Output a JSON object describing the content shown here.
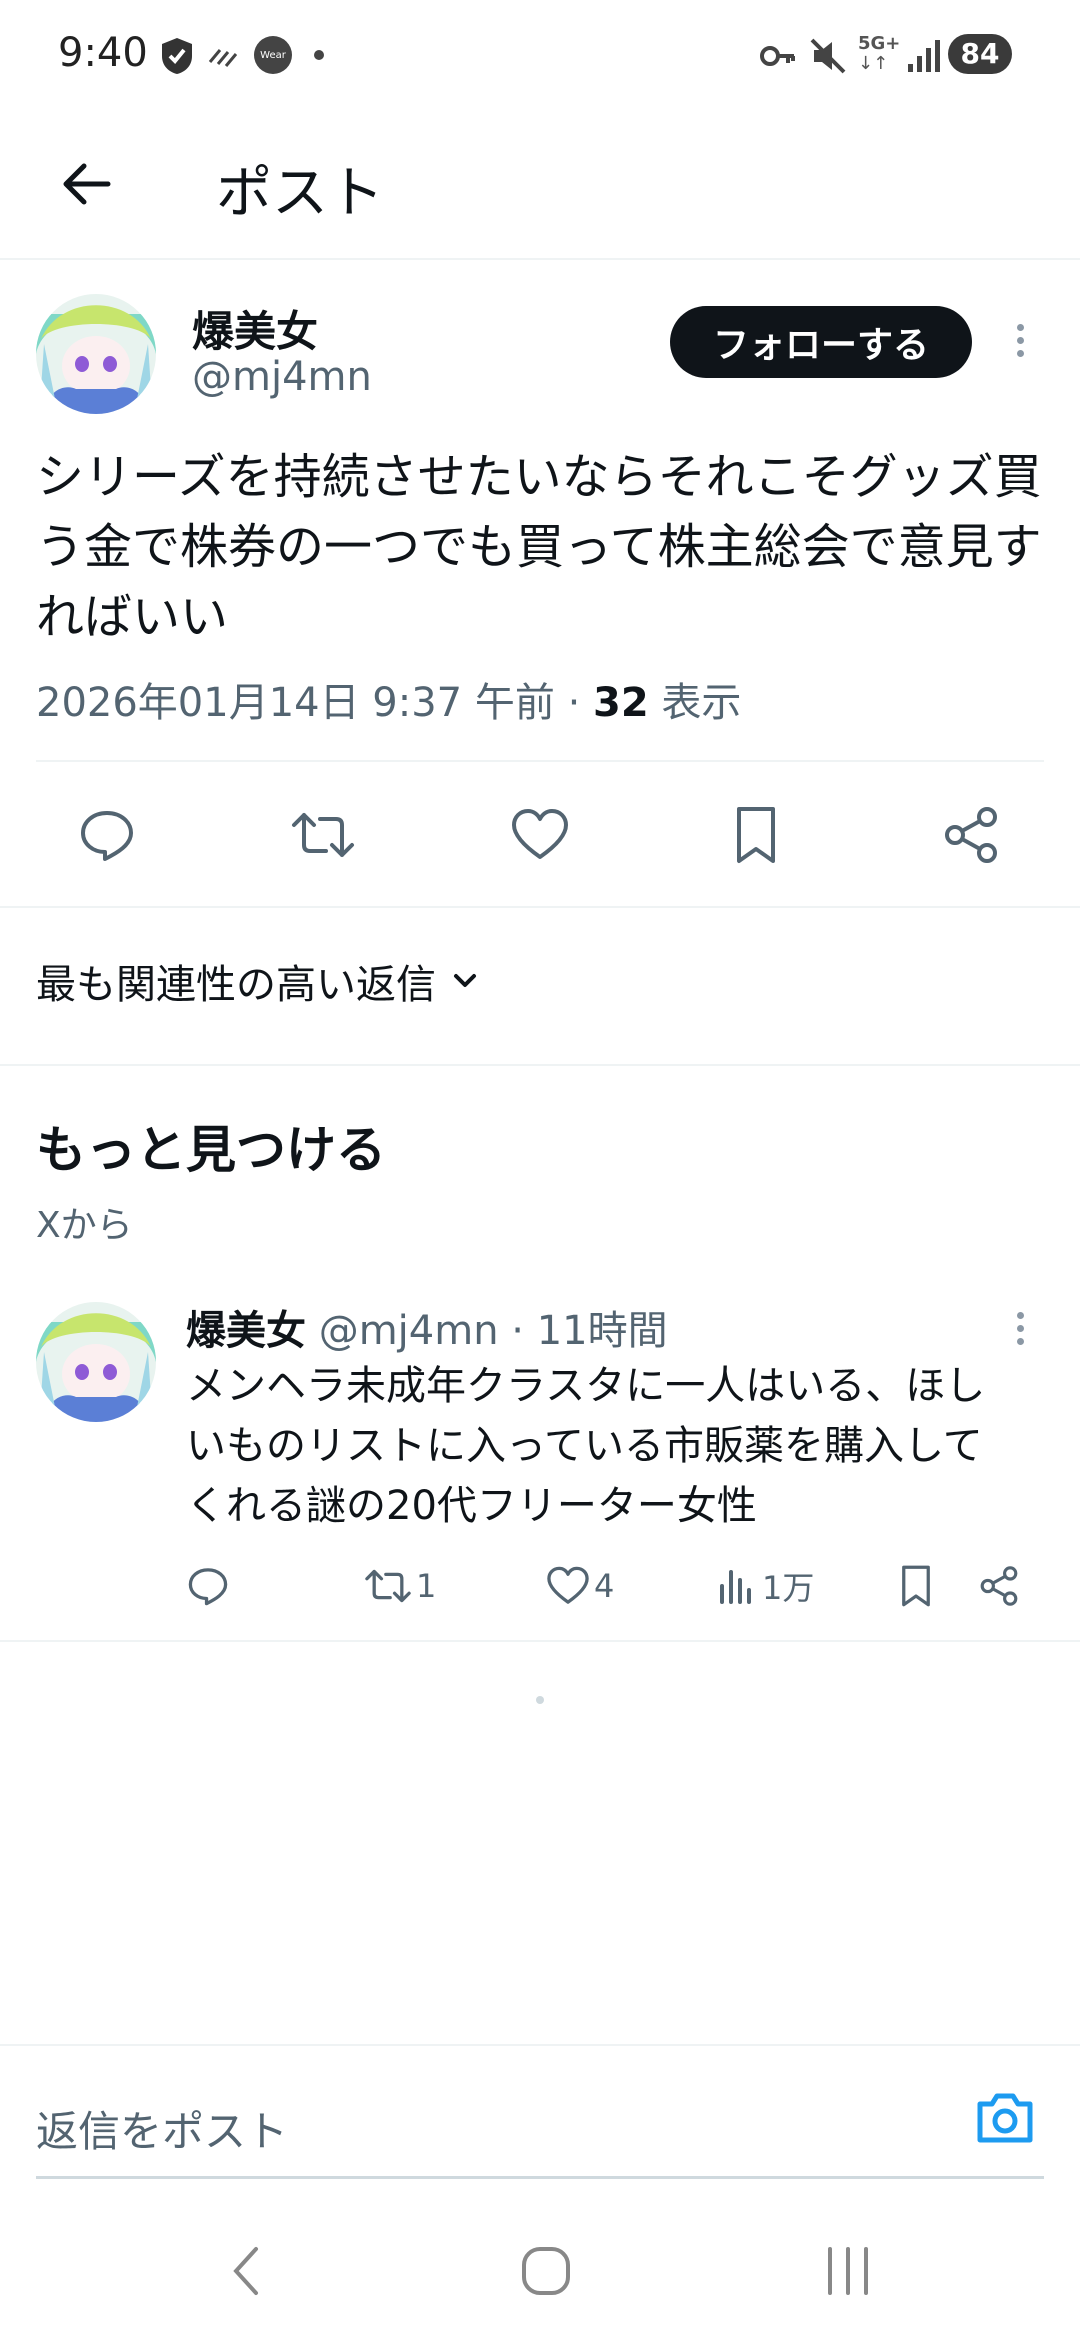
{
  "status_bar": {
    "time": "9:40",
    "battery": "84",
    "network": "5G+",
    "wear_label": "Wear",
    "icons": [
      "shield-check-icon",
      "wear-icon",
      "key-icon",
      "mute-icon",
      "signal-icon"
    ]
  },
  "header": {
    "title": "ポスト",
    "back_icon": "arrow-left-icon"
  },
  "post": {
    "author_name": "爆美女",
    "author_handle": "@mj4mn",
    "follow_label": "フォローする",
    "text": "シリーズを持続させたいならそれこそグッズ買う金で株券の一つでも買って株主総会で意見すればいい",
    "timestamp": "2026年01月14日 9:37 午前",
    "separator": "·",
    "views_count": "32",
    "views_label": "表示",
    "actions": [
      "reply-icon",
      "repost-icon",
      "like-icon",
      "bookmark-icon",
      "share-icon"
    ]
  },
  "replies_sort": {
    "label": "最も関連性の高い返信"
  },
  "discover": {
    "title": "もっと見つける",
    "subtitle": "Xから"
  },
  "recommended_post": {
    "author_name": "爆美女",
    "author_handle": "@mj4mn",
    "separator": "·",
    "time_ago": "11時間",
    "text": "メンヘラ未成年クラスタに一人はいる、ほしいものリストに入っている市販薬を購入してくれる謎の20代フリーター女性",
    "reposts": "1",
    "likes": "4",
    "views": "1万"
  },
  "composer": {
    "placeholder": "返信をポスト"
  },
  "colors": {
    "text_primary": "#0f1419",
    "text_secondary": "#536471",
    "accent": "#1d9bf0",
    "divider": "#eff3f4"
  }
}
